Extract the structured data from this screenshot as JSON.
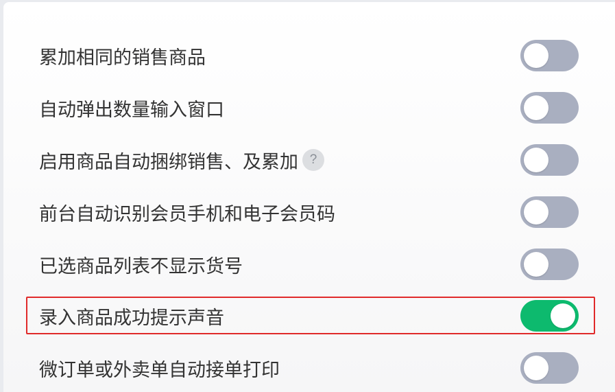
{
  "settings": [
    {
      "label": "累加相同的销售商品",
      "enabled": false,
      "has_help": false
    },
    {
      "label": "自动弹出数量输入窗口",
      "enabled": false,
      "has_help": false
    },
    {
      "label": "启用商品自动捆绑销售、及累加",
      "enabled": false,
      "has_help": true,
      "help_glyph": "?"
    },
    {
      "label": "前台自动识别会员手机和电子会员码",
      "enabled": false,
      "has_help": false
    },
    {
      "label": "已选商品列表不显示货号",
      "enabled": false,
      "has_help": false
    },
    {
      "label": "录入商品成功提示声音",
      "enabled": true,
      "has_help": false,
      "highlighted": true
    },
    {
      "label": "微订单或外卖单自动接单打印",
      "enabled": false,
      "has_help": false
    }
  ],
  "colors": {
    "toggle_on": "#0dba6e",
    "toggle_off": "#a9afc0",
    "highlight_border": "#e02a2a",
    "text": "#333333"
  },
  "icons": {
    "help": "question-mark-circle-icon"
  }
}
